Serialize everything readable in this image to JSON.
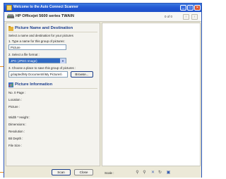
{
  "window": {
    "title": "Welcome to the Auto Connect Scanner",
    "controls": [
      "_",
      "□",
      "✕"
    ]
  },
  "header": {
    "scanner_name": "HP Officejet 5600 series TWAIN",
    "page_count": "0 of 0",
    "prev_glyph": "‹",
    "next_glyph": "›"
  },
  "picture_section": {
    "title": "Picture Name and Destination",
    "instruction": "Select a name and destination for your pictures",
    "step1_label": "1. Type a name for this group of pictures:",
    "name_value": "Picture",
    "step2_label": "2. Select a file format :",
    "format_value": "JPG (JPEG Image)",
    "step3_label": "3. Choose a place to save this group of pictures :",
    "path_value": "gs\\apted\\My Documents\\My Pictures\\",
    "browse_label": "Browse..."
  },
  "info_section": {
    "title": "Picture Information",
    "fields": [
      "No. 0 Page :",
      "Location :",
      "Picture :",
      "Width * Height :",
      "Dimensions :",
      "Resolution :",
      "Bit Depth :",
      "File Size :"
    ]
  },
  "footer": {
    "scan_label": "Scan",
    "close_label": "Close",
    "scale_label": "Scale :",
    "tools": [
      "zoom-in-icon",
      "zoom-out-icon",
      "delete-icon",
      "rotate-icon",
      "save-icon"
    ]
  },
  "colors": {
    "titlebar": "#2459d4",
    "section_title": "#1c3e8c",
    "callout": "#e88a1a",
    "selected": "#316ac5"
  }
}
